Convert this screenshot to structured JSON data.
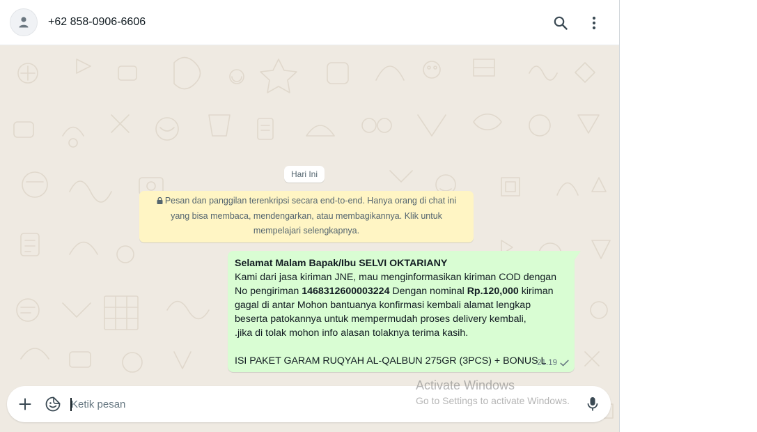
{
  "header": {
    "contact_name": "+62 858-0906-6606",
    "avatar_icon": "default-avatar-icon",
    "search_icon": "search-icon",
    "menu_icon": "vertical-dots-icon"
  },
  "chat": {
    "date_divider": "Hari Ini",
    "encryption_notice": {
      "lines": [
        "Pesan dan panggilan terenkripsi secara end-to-end. Hanya orang di chat ini",
        "yang bisa membaca, mendengarkan, atau membagikannya. Klik untuk",
        "mempelajari selengkapnya."
      ]
    },
    "message": {
      "greeting": "Selamat Malam Bapak/Ibu SELVI OKTARIANY",
      "line1": "Kami dari jasa kiriman JNE, mau menginformasikan kiriman COD dengan",
      "line2_a": "No pengiriman ",
      "tracking_number": "1468312600003224",
      "line2_b": " Dengan nominal ",
      "amount": "Rp.120,000",
      "line2_c": " kiriman",
      "line3": "gagal di antar Mohon bantuanya konfirmasi kembali alamat lengkap",
      "line4": "beserta patokannya untuk mempermudah proses delivery kembali,",
      "line5": " .jika di tolak mohon info alasan tolaknya terima kasih.",
      "line6": "ISI PAKET GARAM RUQYAH AL-QALBUN 275GR (3PCS) + BONUS L",
      "time": "21.19",
      "status_icon": "single-check-icon"
    }
  },
  "footer": {
    "input_placeholder": "Ketik pesan",
    "attach_icon": "plus-icon",
    "sticker_icon": "sticker-icon",
    "mic_icon": "microphone-icon"
  },
  "watermark": {
    "title": "Activate Windows",
    "subtitle": "Go to Settings to activate Windows."
  },
  "colors": {
    "chat_background": "#efeae2",
    "outgoing_bubble": "#d9fdd3",
    "encryption_notice_bg": "#fff5c4",
    "icon_gray": "#54656f"
  }
}
